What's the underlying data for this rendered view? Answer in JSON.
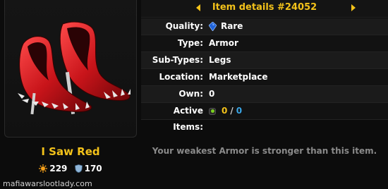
{
  "item": {
    "name": "I Saw Red",
    "attack": "229",
    "defense": "170"
  },
  "header": {
    "title": "Item details #24052"
  },
  "details": {
    "quality_label": "Quality:",
    "quality_value": "Rare",
    "type_label": "Type:",
    "type_value": "Armor",
    "subtypes_label": "Sub-Types:",
    "subtypes_value": "Legs",
    "location_label": "Location:",
    "location_value": "Marketplace",
    "own_label": "Own:",
    "own_value": "0",
    "active_label": "Active Items:",
    "active_owned": "0",
    "active_separator": "/",
    "active_count": "0"
  },
  "note": "Your weakest Armor is stronger than this item.",
  "credit": "mafiawarslootlady.com",
  "colors": {
    "accent": "#f3c21a",
    "rare_gem": "#1f62d8",
    "active_blue": "#3aa6e6",
    "active_green": "#7bd11f"
  }
}
